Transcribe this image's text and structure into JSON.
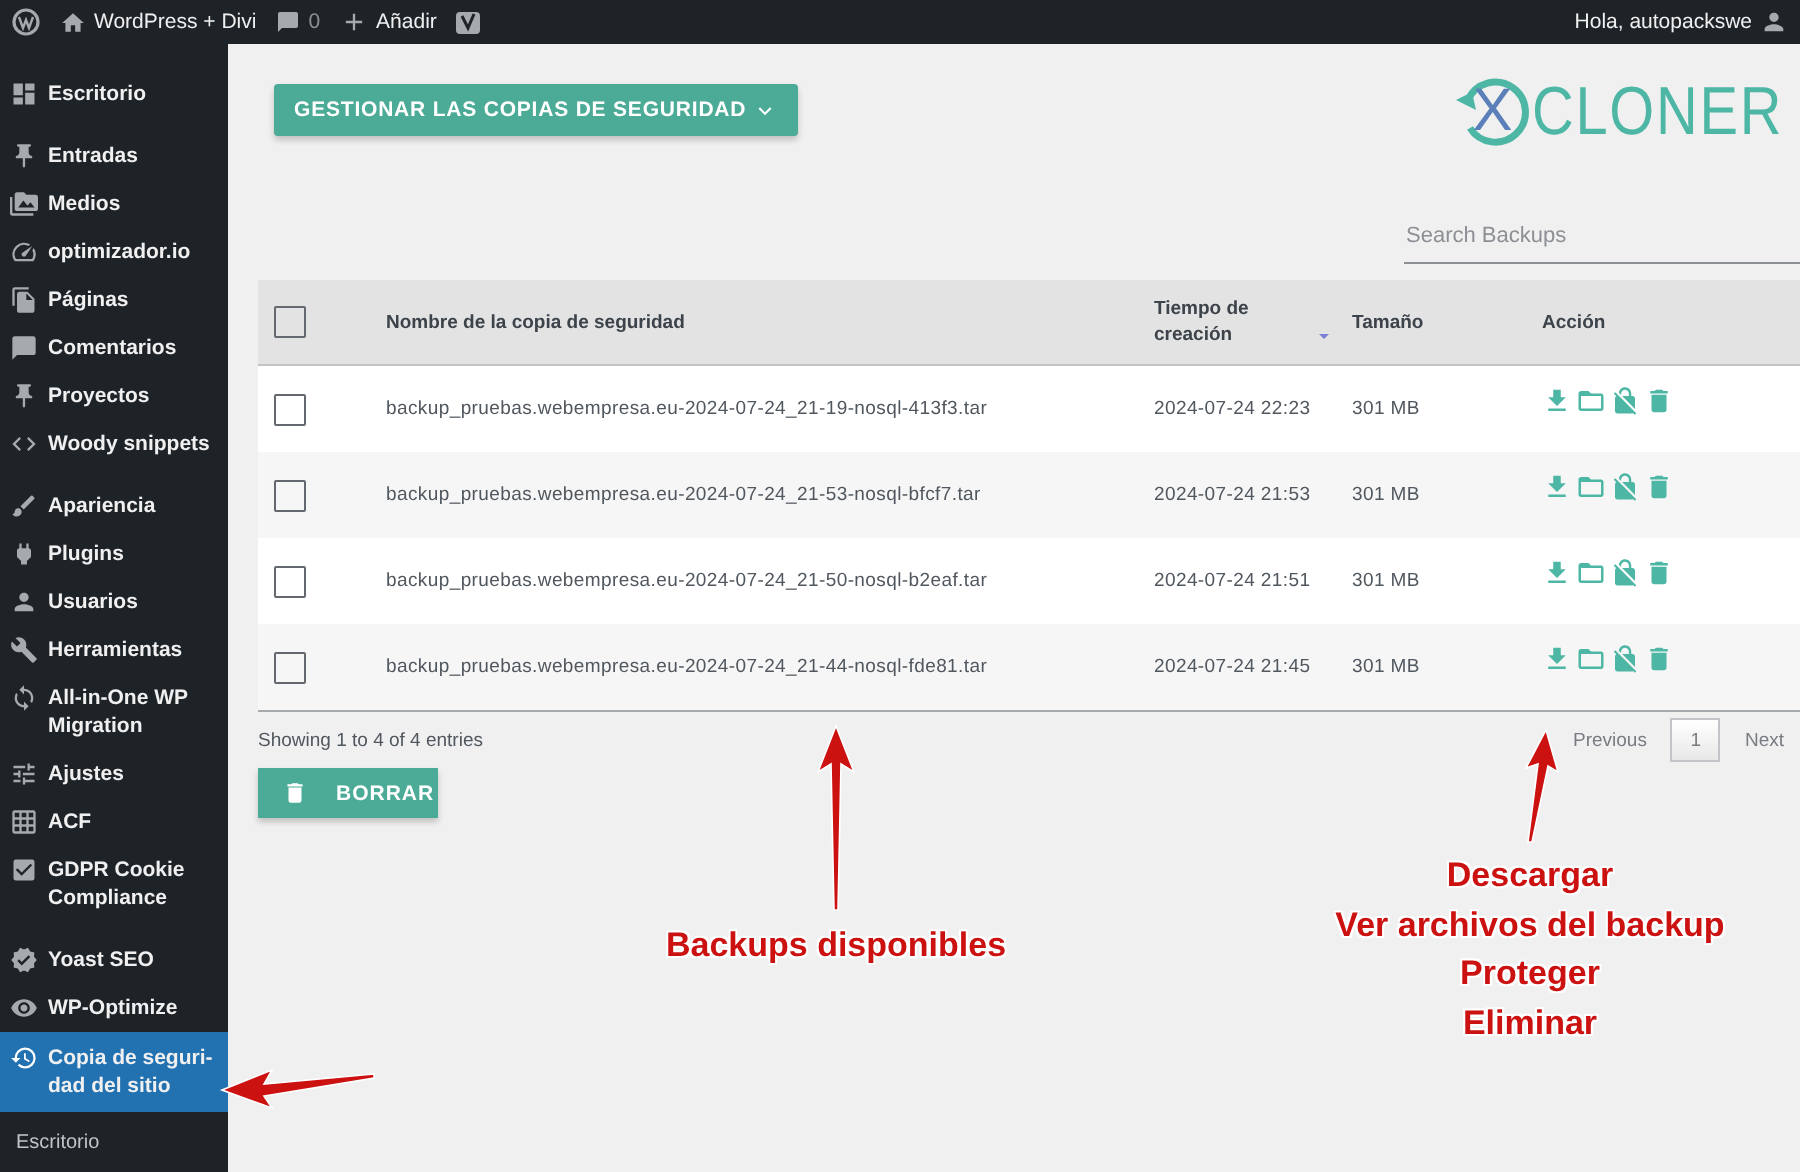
{
  "admin_bar": {
    "site_name": "WordPress + Divi",
    "comments": "0",
    "new": "Añadir",
    "greeting": "Hola, autopackswe"
  },
  "sidebar": {
    "groups": [
      [
        {
          "label": "Escritorio",
          "selected": false
        }
      ],
      [
        {
          "label": "Entradas",
          "selected": false
        },
        {
          "label": "Medios",
          "selected": false
        },
        {
          "label": "optimizador.io",
          "selected": false
        },
        {
          "label": "Páginas",
          "selected": false
        },
        {
          "label": "Comentarios",
          "selected": false
        },
        {
          "label": "Proyectos",
          "selected": false
        },
        {
          "label": "Woody snippets",
          "selected": false
        }
      ],
      [
        {
          "label": "Apariencia",
          "selected": false
        },
        {
          "label": "Plugins",
          "selected": false
        },
        {
          "label": "Usuarios",
          "selected": false
        },
        {
          "label": "Herramientas",
          "selected": false
        },
        {
          "label": "All-in-One WP Migration",
          "selected": false
        },
        {
          "label": "Ajustes",
          "selected": false
        },
        {
          "label": "ACF",
          "selected": false
        },
        {
          "label": "GDPR Cookie Compliance",
          "selected": false
        }
      ],
      [
        {
          "label": "Yoast SEO",
          "selected": false
        },
        {
          "label": "WP-Optimize",
          "selected": false
        },
        {
          "label": "Copia de seguri-dad del sitio",
          "selected": true
        }
      ]
    ],
    "submenu": [
      "Escritorio"
    ]
  },
  "manage_button": "GESTIONAR LAS COPIAS DE SEGURIDAD",
  "logo": {
    "mark": "X",
    "name": "CLONER"
  },
  "search": {
    "placeholder": "Search Backups"
  },
  "table": {
    "select_all_checked": false,
    "columns": [
      {
        "label": "Nombre de la copia de seguridad",
        "sorted": false
      },
      {
        "label": "Tiempo de creación",
        "sorted": true
      },
      {
        "label": "Tamaño",
        "sorted": false
      },
      {
        "label": "Acción",
        "sorted": false
      }
    ],
    "rows": [
      {
        "checked": false,
        "name": "backup_pruebas.webempresa.eu-2024-07-24_21-19-nosql-413f3.tar",
        "created": "2024-07-24 22:23",
        "size": "301 MB"
      },
      {
        "checked": false,
        "name": "backup_pruebas.webempresa.eu-2024-07-24_21-53-nosql-bfcf7.tar",
        "created": "2024-07-24 21:53",
        "size": "301 MB"
      },
      {
        "checked": false,
        "name": "backup_pruebas.webempresa.eu-2024-07-24_21-50-nosql-b2eaf.tar",
        "created": "2024-07-24 21:51",
        "size": "301 MB"
      },
      {
        "checked": false,
        "name": "backup_pruebas.webempresa.eu-2024-07-24_21-44-nosql-fde81.tar",
        "created": "2024-07-24 21:45",
        "size": "301 MB"
      }
    ]
  },
  "footer": {
    "summary": "Showing 1 to 4 of 4 entries",
    "previous": "Previous",
    "pages": [
      {
        "label": "1",
        "selected": true
      }
    ],
    "next": "Next"
  },
  "delete_button": "BORRAR",
  "annotations": [
    [
      "Backups disponibles"
    ],
    [
      "Descargar",
      "Ver archivos del backup",
      "Proteger",
      "Eliminar"
    ]
  ]
}
